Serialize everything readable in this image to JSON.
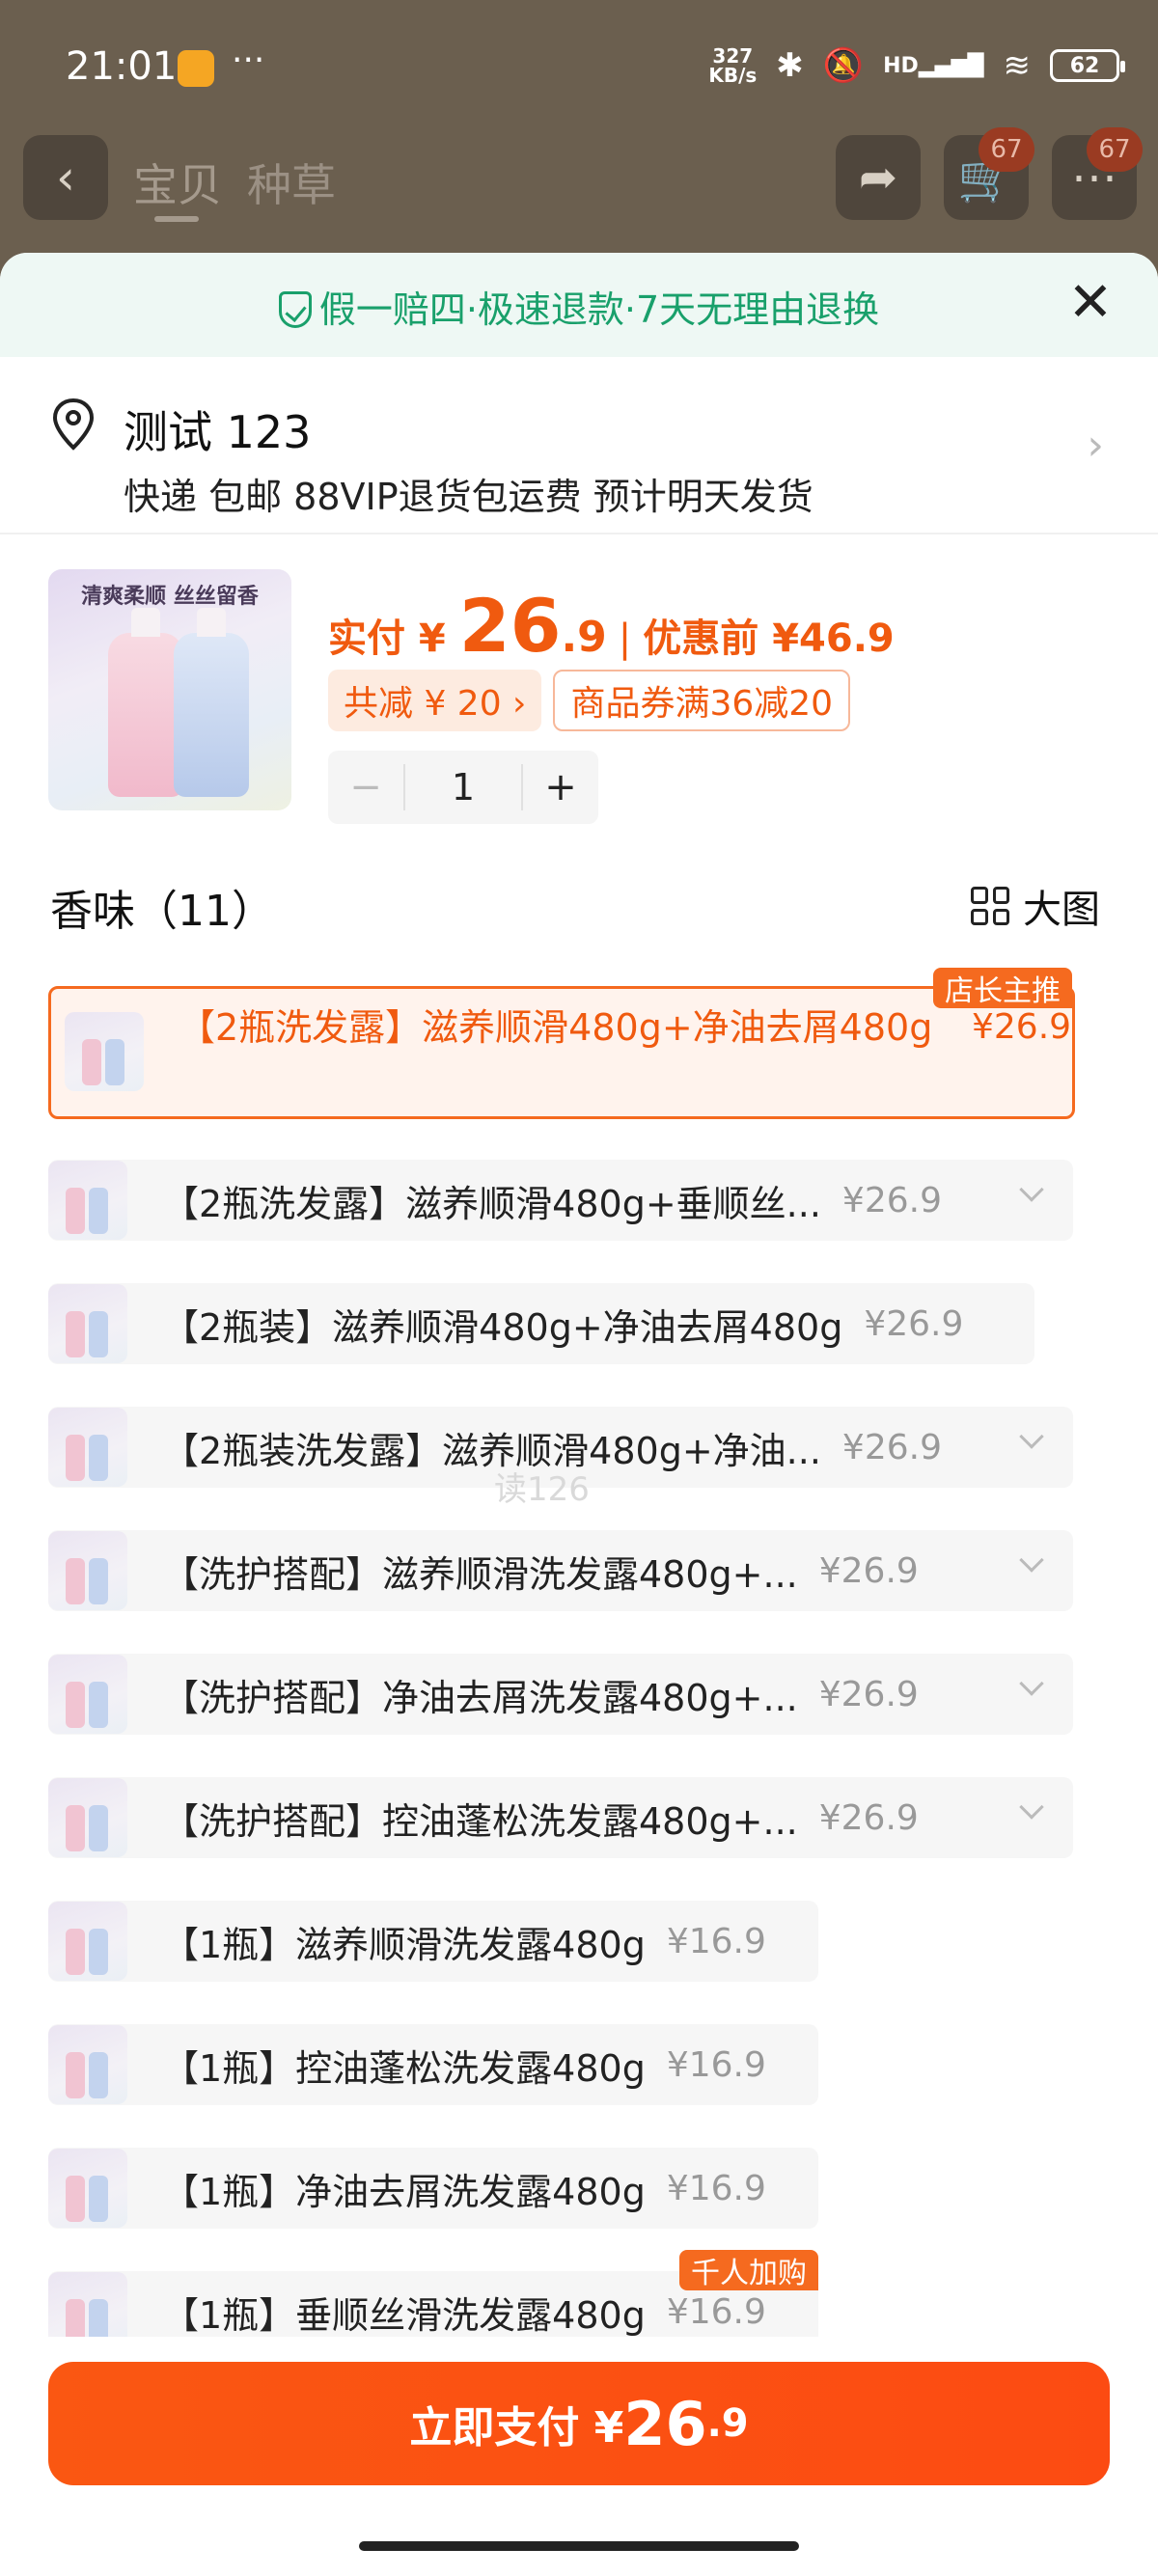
{
  "status": {
    "time": "21:01",
    "netspeed_value": "327",
    "netspeed_unit": "KB/s",
    "hd": "HD",
    "battery": "62",
    "dots": "···"
  },
  "nav": {
    "back_icon": "‹",
    "tab1": "宝贝",
    "tab2": "种草",
    "cart_badge": "67",
    "more_badge": "67"
  },
  "sheet": {
    "guarantee": "假一赔四·极速退款·7天无理由退换",
    "close": "✕"
  },
  "address": {
    "name": "测试 123",
    "info": "快递 包邮 88VIP退货包运费 预计明天发货",
    "arrow": "›"
  },
  "product": {
    "image_text": "清爽柔顺  丝丝留香",
    "price_label": "实付 ¥ ",
    "price_main": "26",
    "price_dec": ".9",
    "separator": "|",
    "price_before": "优惠前 ¥46.9",
    "discount_chip": "共减 ¥ 20 ›",
    "coupon_chip": "商品券满36减20",
    "qty": "1",
    "minus": "−",
    "plus": "+"
  },
  "section": {
    "title": "香味（11）",
    "toggle": "大图"
  },
  "options": [
    {
      "text": "【2瓶洗发露】滋养顺滑480g+净油去屑480g",
      "price": "¥26.9",
      "selected": true,
      "tag": "店长主推"
    },
    {
      "text": "【2瓶洗发露】滋养顺滑480g+垂顺丝...",
      "price": "¥26.9"
    },
    {
      "text": "【2瓶装】滋养顺滑480g+净油去屑480g",
      "price": "¥26.9"
    },
    {
      "text": "【2瓶装洗发露】滋养顺滑480g+净油...",
      "price": "¥26.9"
    },
    {
      "text": "【洗护搭配】滋养顺滑洗发露480g+...",
      "price": "¥26.9"
    },
    {
      "text": "【洗护搭配】净油去屑洗发露480g+...",
      "price": "¥26.9"
    },
    {
      "text": "【洗护搭配】控油蓬松洗发露480g+...",
      "price": "¥26.9"
    },
    {
      "text": "【1瓶】滋养顺滑洗发露480g",
      "price": "¥16.9"
    },
    {
      "text": "【1瓶】控油蓬松洗发露480g",
      "price": "¥16.9"
    },
    {
      "text": "【1瓶】净油去屑洗发露480g",
      "price": "¥16.9"
    },
    {
      "text": "【1瓶】垂顺丝滑洗发露480g",
      "price": "¥16.9",
      "tag": "千人加购"
    }
  ],
  "watermark": "读126",
  "pay": {
    "label": "立即支付 ¥",
    "main": "26",
    "dec": ".9"
  }
}
